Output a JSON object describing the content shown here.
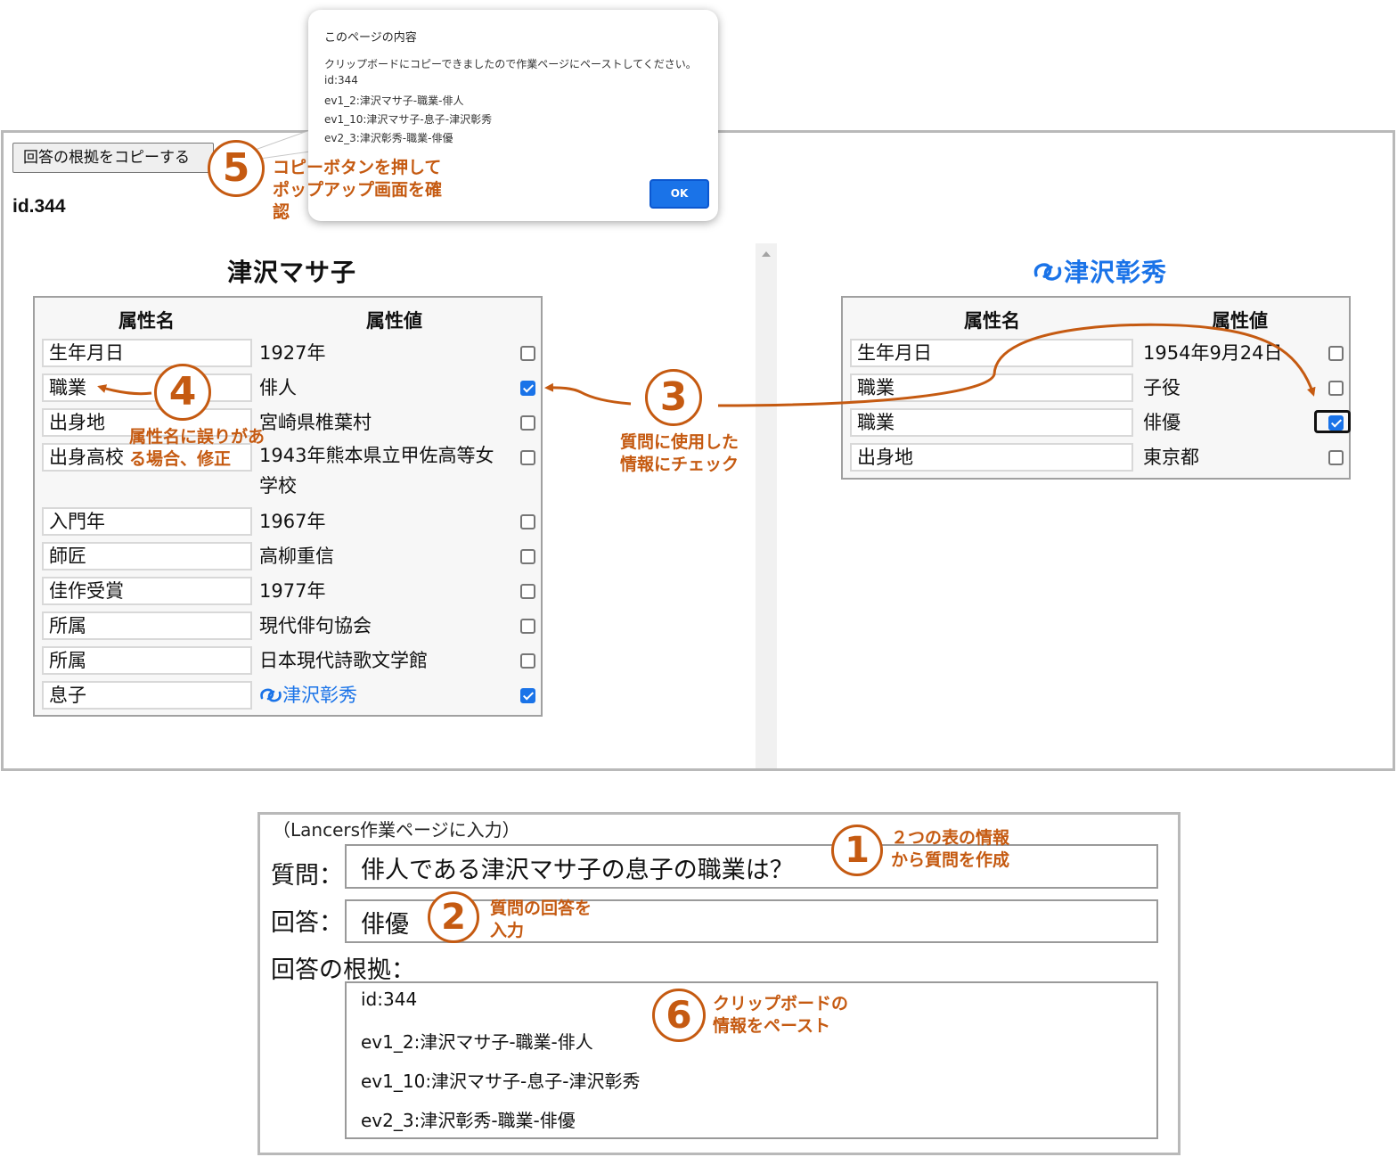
{
  "top_panel": {
    "copy_button_label": "回答の根拠をコピーする",
    "page_id": "id.344"
  },
  "left_entity": {
    "title": "津沢マサ子",
    "header_name": "属性名",
    "header_value": "属性値",
    "rows": [
      {
        "name": "生年月日",
        "value": "1927年",
        "checked": false
      },
      {
        "name": "職業",
        "value": "俳人",
        "checked": true
      },
      {
        "name": "出身地",
        "value": "宮崎県椎葉村",
        "checked": false
      },
      {
        "name": "出身高校",
        "value": "1943年熊本県立甲佐高等女学校",
        "checked": false
      },
      {
        "name": "入門年",
        "value": "1967年",
        "checked": false
      },
      {
        "name": "師匠",
        "value": "高柳重信",
        "checked": false
      },
      {
        "name": "佳作受賞",
        "value": "1977年",
        "checked": false
      },
      {
        "name": "所属",
        "value": "現代俳句協会",
        "checked": false
      },
      {
        "name": "所属",
        "value": "日本現代詩歌文学館",
        "checked": false
      },
      {
        "name": "息子",
        "value": "津沢彰秀",
        "checked": true,
        "link": true
      }
    ]
  },
  "right_entity": {
    "title": "津沢彰秀",
    "header_name": "属性名",
    "header_value": "属性値",
    "rows": [
      {
        "name": "生年月日",
        "value": "1954年9月24日",
        "checked": false
      },
      {
        "name": "職業",
        "value": "子役",
        "checked": false
      },
      {
        "name": "職業",
        "value": "俳優",
        "checked": true
      },
      {
        "name": "出身地",
        "value": "東京都",
        "checked": false
      }
    ]
  },
  "dialog": {
    "title": "このページの内容",
    "message": "クリップボードにコピーできましたので作業ページにペーストしてください。",
    "lines": [
      "id:344",
      "ev1_2:津沢マサ子-職業-俳人",
      "ev1_10:津沢マサ子-息子-津沢彰秀",
      "ev2_3:津沢彰秀-職業-俳優"
    ],
    "ok_label": "OK"
  },
  "annotations": {
    "step1": {
      "num": "1",
      "text": "２つの表の情報\nから質問を作成"
    },
    "step2": {
      "num": "2",
      "text": "質問の回答を\n入力"
    },
    "step3": {
      "num": "3",
      "text": "質問に使用した\n情報にチェック"
    },
    "step4": {
      "num": "4",
      "text": "属性名に誤りがあ\nる場合、修正"
    },
    "step5": {
      "num": "5",
      "text": "コピーボタンを押して\nポップアップ画面を確\n認"
    },
    "step6": {
      "num": "6",
      "text": "クリップボードの\n情報をペースト"
    },
    "accent_color": "#c55a11"
  },
  "work_form": {
    "hint": "（Lancers作業ページに入力）",
    "question_label": "質問：",
    "question_value": "俳人である津沢マサ子の息子の職業は？",
    "answer_label": "回答：",
    "answer_value": "俳優",
    "evidence_label": "回答の根拠：",
    "evidence_lines": [
      "id:344",
      "ev1_2:津沢マサ子-職業-俳人",
      "ev1_10:津沢マサ子-息子-津沢彰秀",
      "ev2_3:津沢彰秀-職業-俳優"
    ]
  },
  "icons": {
    "link_icon": "link-icon",
    "accent_blue": "#1a73e8"
  }
}
